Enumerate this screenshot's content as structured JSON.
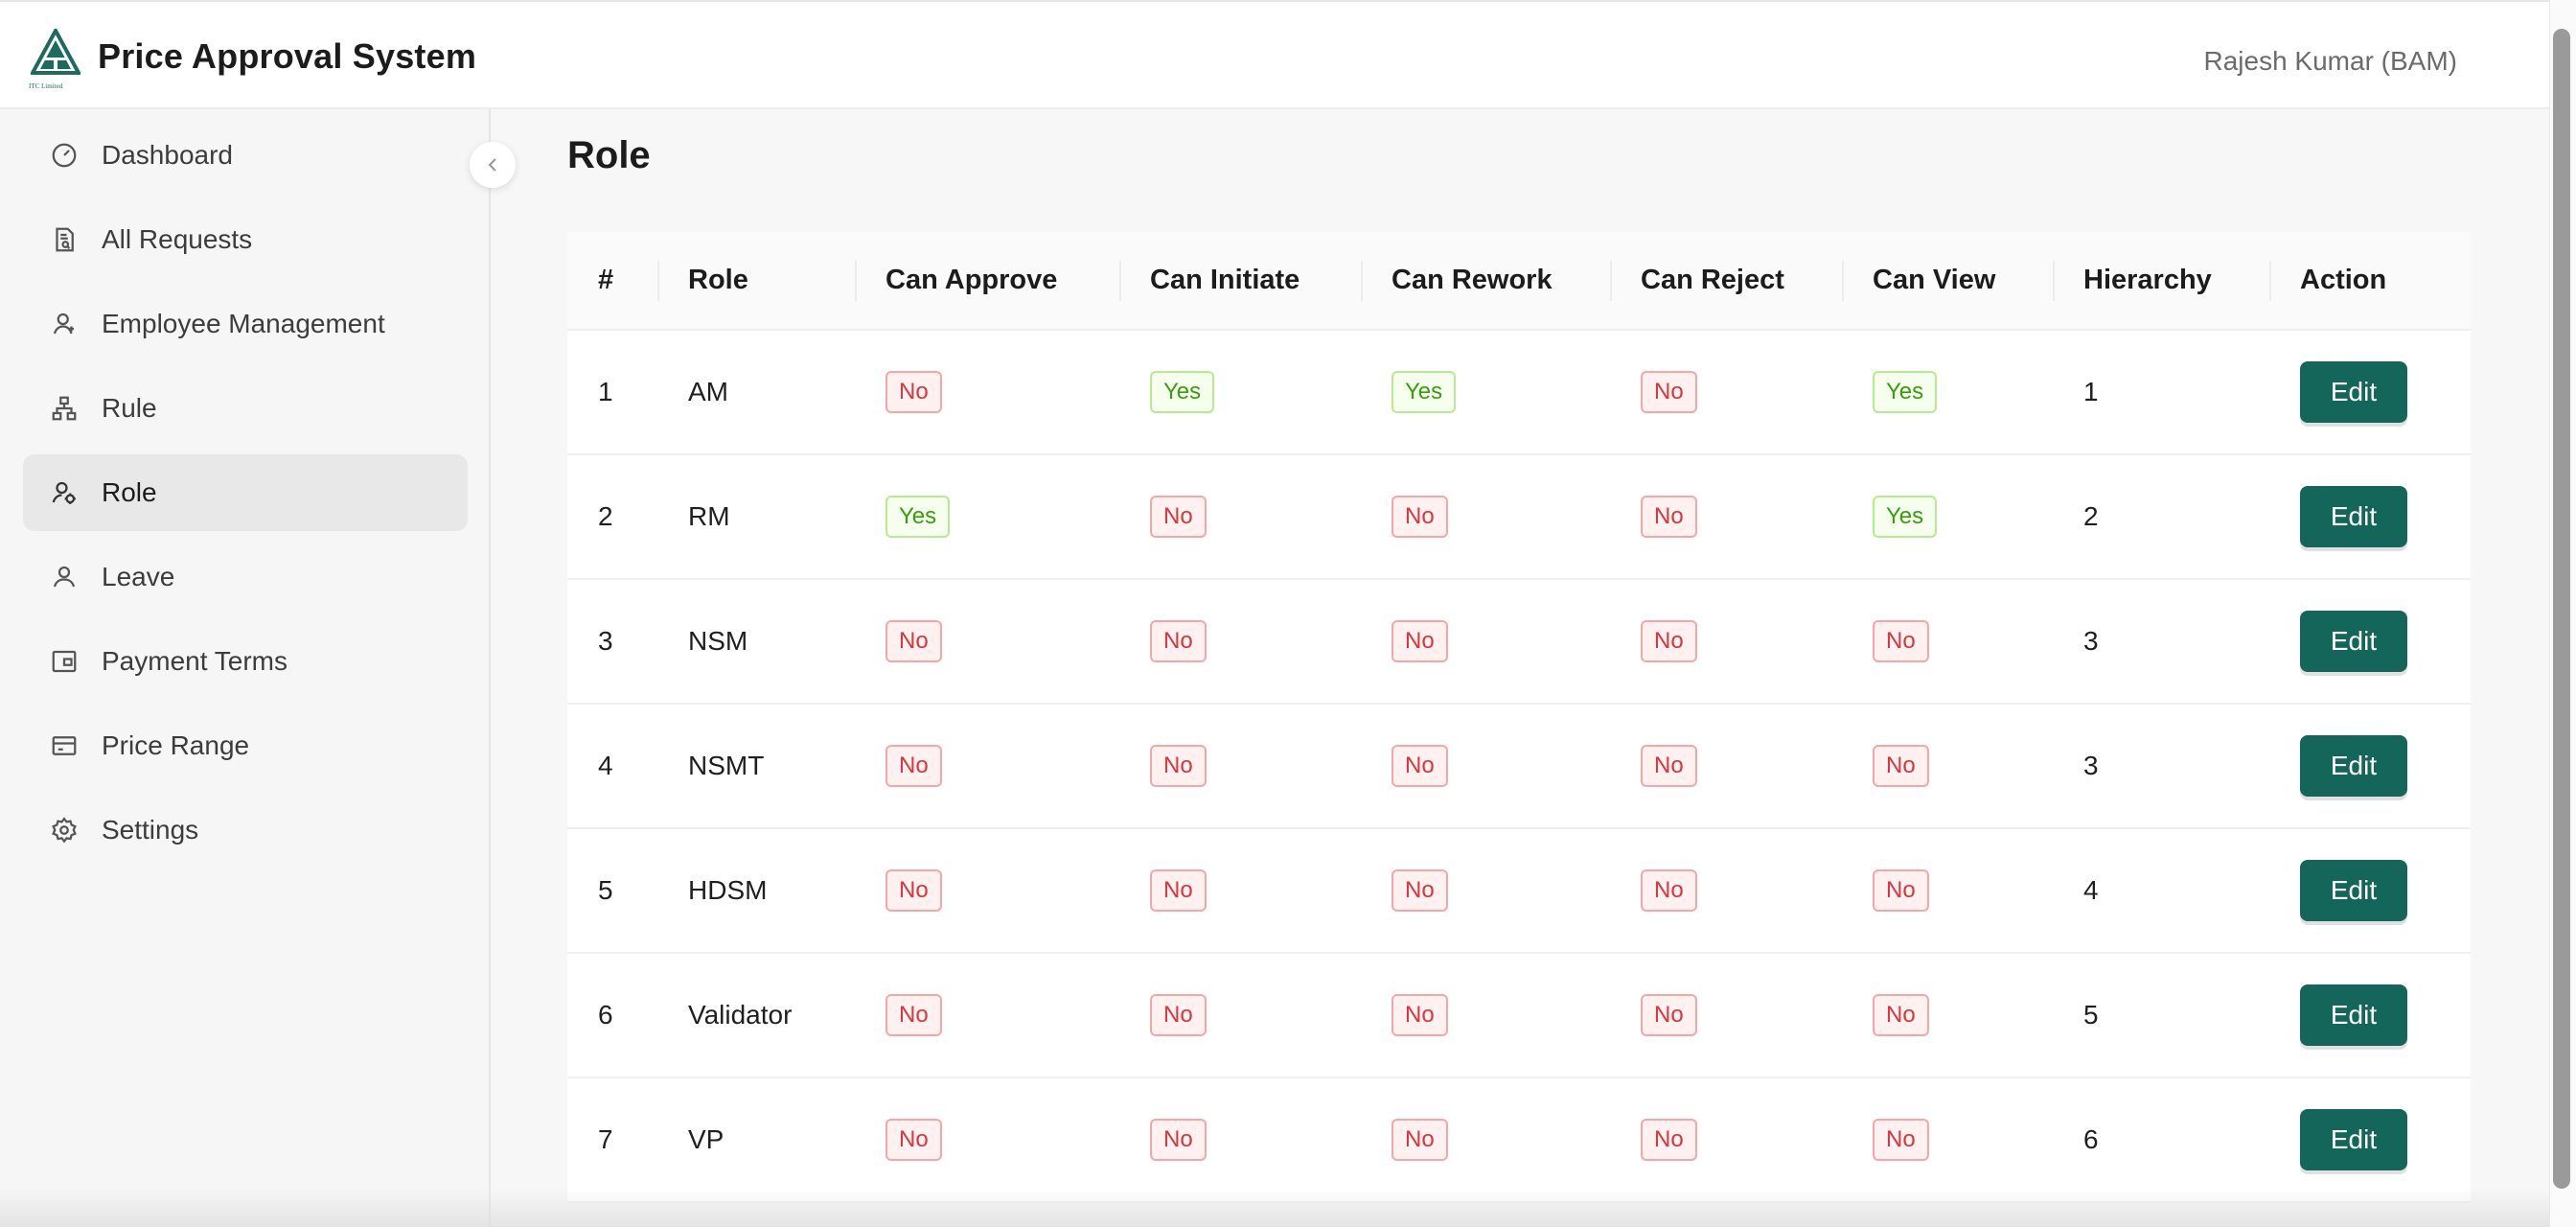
{
  "header": {
    "app_title": "Price Approval System",
    "logo_caption": "ITC Limited",
    "user": "Rajesh Kumar (BAM)"
  },
  "sidebar": {
    "items": [
      {
        "label": "Dashboard",
        "icon": "dashboard-icon"
      },
      {
        "label": "All Requests",
        "icon": "file-search-icon"
      },
      {
        "label": "Employee Management",
        "icon": "user-icon"
      },
      {
        "label": "Rule",
        "icon": "hierarchy-icon"
      },
      {
        "label": "Role",
        "icon": "user-settings-icon",
        "active": true
      },
      {
        "label": "Leave",
        "icon": "user-icon"
      },
      {
        "label": "Payment Terms",
        "icon": "wallet-icon"
      },
      {
        "label": "Price Range",
        "icon": "credit-card-icon"
      },
      {
        "label": "Settings",
        "icon": "gear-icon"
      }
    ],
    "collapse_icon": "chevron-left-icon"
  },
  "main": {
    "page_title": "Role",
    "table": {
      "columns": [
        "#",
        "Role",
        "Can Approve",
        "Can Initiate",
        "Can Rework",
        "Can Reject",
        "Can View",
        "Hierarchy",
        "Action"
      ],
      "rows": [
        {
          "num": "1",
          "role": "AM",
          "approve": "No",
          "initiate": "Yes",
          "rework": "Yes",
          "reject": "No",
          "view": "Yes",
          "hierarchy": "1",
          "action": "Edit"
        },
        {
          "num": "2",
          "role": "RM",
          "approve": "Yes",
          "initiate": "No",
          "rework": "No",
          "reject": "No",
          "view": "Yes",
          "hierarchy": "2",
          "action": "Edit"
        },
        {
          "num": "3",
          "role": "NSM",
          "approve": "No",
          "initiate": "No",
          "rework": "No",
          "reject": "No",
          "view": "No",
          "hierarchy": "3",
          "action": "Edit"
        },
        {
          "num": "4",
          "role": "NSMT",
          "approve": "No",
          "initiate": "No",
          "rework": "No",
          "reject": "No",
          "view": "No",
          "hierarchy": "3",
          "action": "Edit"
        },
        {
          "num": "5",
          "role": "HDSM",
          "approve": "No",
          "initiate": "No",
          "rework": "No",
          "reject": "No",
          "view": "No",
          "hierarchy": "4",
          "action": "Edit"
        },
        {
          "num": "6",
          "role": "Validator",
          "approve": "No",
          "initiate": "No",
          "rework": "No",
          "reject": "No",
          "view": "No",
          "hierarchy": "5",
          "action": "Edit"
        },
        {
          "num": "7",
          "role": "VP",
          "approve": "No",
          "initiate": "No",
          "rework": "No",
          "reject": "No",
          "view": "No",
          "hierarchy": "6",
          "action": "Edit"
        }
      ]
    }
  },
  "colors": {
    "primary": "#15665a",
    "no_text": "#d9363e",
    "no_bg": "#fff1f0",
    "yes_text": "#389e0d",
    "yes_bg": "#f6ffed"
  }
}
